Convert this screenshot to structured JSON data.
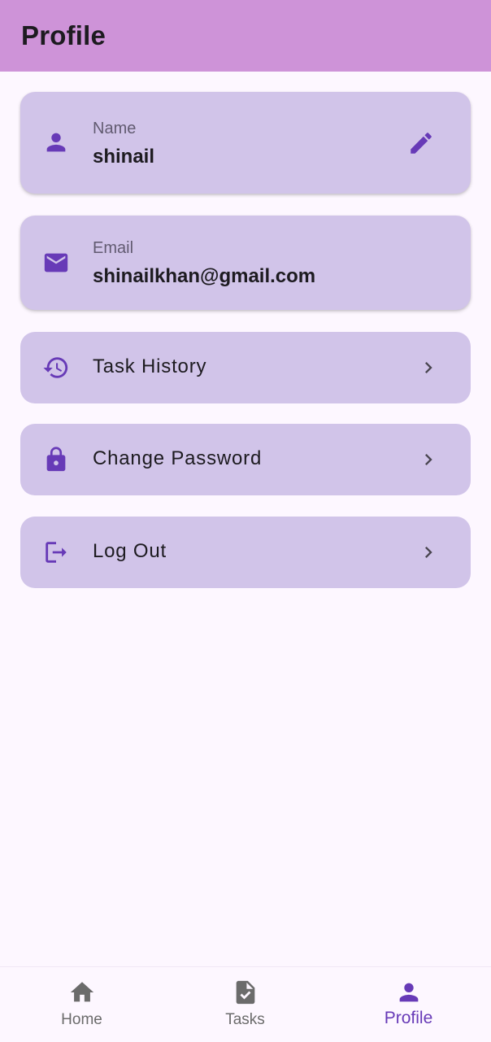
{
  "appbar": {
    "title": "Profile"
  },
  "profile": {
    "name_label": "Name",
    "name_value": "shinail",
    "email_label": "Email",
    "email_value": "shinailkhan@gmail.com"
  },
  "menu": {
    "items": [
      {
        "label": "Task History",
        "icon": "history-icon"
      },
      {
        "label": "Change Password",
        "icon": "lock-icon"
      },
      {
        "label": "Log Out",
        "icon": "logout-icon"
      }
    ]
  },
  "bottom_nav": {
    "items": [
      {
        "label": "Home",
        "icon": "home-icon"
      },
      {
        "label": "Tasks",
        "icon": "task-file-icon"
      },
      {
        "label": "Profile",
        "icon": "person-icon",
        "selected": true
      }
    ]
  },
  "colors": {
    "appbar": "#ce93d8",
    "card": "#d1c4e9",
    "accent": "#673ab7",
    "background": "#fdf7ff"
  }
}
